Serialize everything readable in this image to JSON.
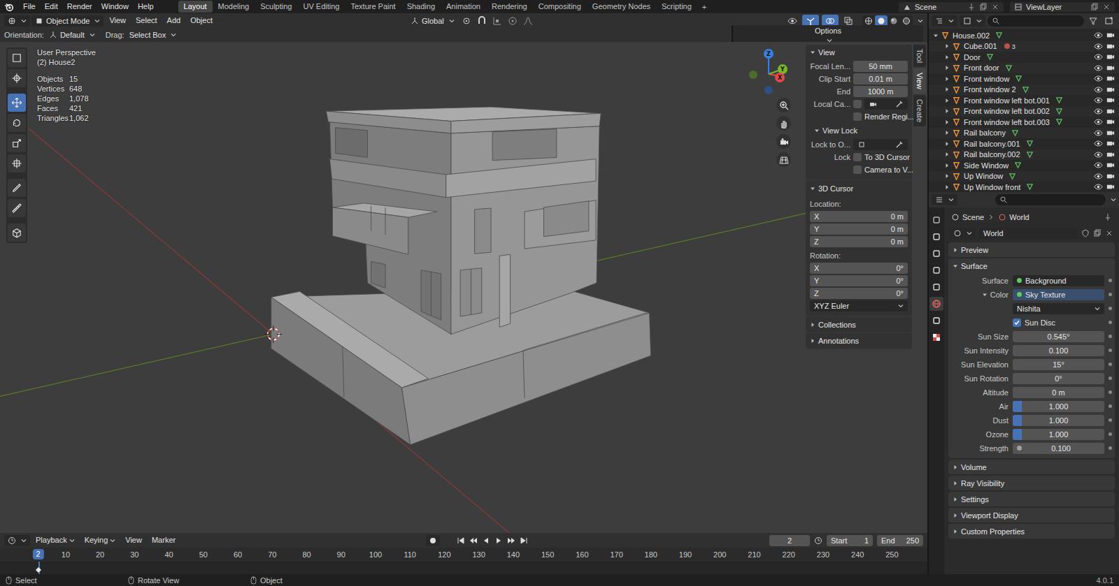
{
  "topbar": {
    "menus": [
      "File",
      "Edit",
      "Render",
      "Window",
      "Help"
    ],
    "workspaces": [
      {
        "label": "Layout",
        "selected": true
      },
      {
        "label": "Modeling",
        "selected": false
      },
      {
        "label": "Sculpting",
        "selected": false
      },
      {
        "label": "UV Editing",
        "selected": false
      },
      {
        "label": "Texture Paint",
        "selected": false
      },
      {
        "label": "Shading",
        "selected": false
      },
      {
        "label": "Animation",
        "selected": false
      },
      {
        "label": "Rendering",
        "selected": false
      },
      {
        "label": "Compositing",
        "selected": false
      },
      {
        "label": "Geometry Nodes",
        "selected": false
      },
      {
        "label": "Scripting",
        "selected": false
      }
    ],
    "add_workspace": "+",
    "scene": "Scene",
    "view_layer": "ViewLayer"
  },
  "viewport_header": {
    "mode": "Object Mode",
    "menus": [
      "View",
      "Select",
      "Add",
      "Object"
    ],
    "orientation": "Global",
    "shading": [
      {
        "selected": false
      },
      {
        "selected": true
      },
      {
        "selected": false
      },
      {
        "selected": false
      }
    ]
  },
  "tool_settings": {
    "orientation_label": "Orientation:",
    "orientation": "Default",
    "drag_label": "Drag:",
    "drag": "Select Box",
    "options": "Options"
  },
  "viewport": {
    "view_name": "User Perspective",
    "active_object": "(2) House2",
    "stats": [
      {
        "label": "Objects",
        "value": "15"
      },
      {
        "label": "Vertices",
        "value": "648"
      },
      {
        "label": "Edges",
        "value": "1,078"
      },
      {
        "label": "Faces",
        "value": "421"
      },
      {
        "label": "Triangles",
        "value": "1,062"
      }
    ],
    "gizmo_axes": [
      "X",
      "Y",
      "Z"
    ],
    "tools": [
      {
        "selected": false
      },
      {
        "selected": false
      },
      {
        "selected": true
      },
      {
        "selected": false
      },
      {
        "selected": false
      },
      {
        "selected": false
      },
      {
        "selected": false
      },
      {
        "selected": false
      },
      {
        "selected": false
      }
    ]
  },
  "sidebar": {
    "tabs": [
      {
        "label": "Tool",
        "selected": false
      },
      {
        "label": "View",
        "selected": true
      },
      {
        "label": "Create",
        "selected": false
      }
    ],
    "panels": [
      {
        "title": "View",
        "expanded": true,
        "rows": [
          {
            "kind": "field",
            "label": "Focal Len...",
            "value": "50 mm"
          },
          {
            "kind": "field",
            "label": "Clip Start",
            "value": "0.01 m"
          },
          {
            "kind": "field",
            "label": "End",
            "value": "1000 m"
          },
          {
            "kind": "camera",
            "label": "Local Ca...",
            "checked": false
          },
          {
            "kind": "check",
            "label": "Render Regi...",
            "checked": false
          },
          {
            "kind": "subpanel",
            "label": "View Lock",
            "expanded": true
          },
          {
            "kind": "object",
            "label": "Lock to O..."
          },
          {
            "kind": "labeled-check",
            "label": "Lock",
            "text": "To 3D Cursor",
            "checked": false
          },
          {
            "kind": "check",
            "label": "Camera to V...",
            "checked": false
          }
        ]
      },
      {
        "title": "3D Cursor",
        "expanded": true,
        "rows": [
          {
            "kind": "heading",
            "label": "Location:"
          },
          {
            "kind": "axis",
            "label": "X",
            "value": "0 m"
          },
          {
            "kind": "axis",
            "label": "Y",
            "value": "0 m"
          },
          {
            "kind": "axis",
            "label": "Z",
            "value": "0 m"
          },
          {
            "kind": "heading",
            "label": "Rotation:"
          },
          {
            "kind": "axis",
            "label": "X",
            "value": "0°"
          },
          {
            "kind": "axis",
            "label": "Y",
            "value": "0°"
          },
          {
            "kind": "axis",
            "label": "Z",
            "value": "0°"
          },
          {
            "kind": "dropdown",
            "value": "XYZ Euler"
          }
        ]
      },
      {
        "title": "Collections",
        "expanded": false,
        "rows": []
      },
      {
        "title": "Annotations",
        "expanded": false,
        "rows": []
      }
    ]
  },
  "outliner": {
    "items": [
      {
        "name": "House.002",
        "depth": 0,
        "expanded": true,
        "visible": true,
        "renderable": true
      },
      {
        "name": "Cube.001",
        "depth": 1,
        "expanded": false,
        "visible": true,
        "renderable": true,
        "badge": "3"
      },
      {
        "name": "Door",
        "depth": 1,
        "expanded": false,
        "visible": true,
        "renderable": true
      },
      {
        "name": "Front door",
        "depth": 1,
        "expanded": false,
        "visible": true,
        "renderable": true
      },
      {
        "name": "Front window",
        "depth": 1,
        "expanded": false,
        "visible": true,
        "renderable": true
      },
      {
        "name": "Front window 2",
        "depth": 1,
        "expanded": false,
        "visible": true,
        "renderable": true
      },
      {
        "name": "Front window left bot.001",
        "depth": 1,
        "expanded": false,
        "visible": true,
        "renderable": true
      },
      {
        "name": "Front window left bot.002",
        "depth": 1,
        "expanded": false,
        "visible": true,
        "renderable": true
      },
      {
        "name": "Front window left bot.003",
        "depth": 1,
        "expanded": false,
        "visible": true,
        "renderable": true
      },
      {
        "name": "Rail balcony",
        "depth": 1,
        "expanded": false,
        "visible": true,
        "renderable": true
      },
      {
        "name": "Rail balcony.001",
        "depth": 1,
        "expanded": false,
        "visible": true,
        "renderable": true
      },
      {
        "name": "Rail balcony.002",
        "depth": 1,
        "expanded": false,
        "visible": true,
        "renderable": true
      },
      {
        "name": "Side Window",
        "depth": 1,
        "expanded": false,
        "visible": true,
        "renderable": true
      },
      {
        "name": "Up Window",
        "depth": 1,
        "expanded": false,
        "visible": true,
        "renderable": true
      },
      {
        "name": "Up Window front",
        "depth": 1,
        "expanded": false,
        "visible": true,
        "renderable": true
      }
    ]
  },
  "properties": {
    "breadcrumb": [
      "Scene",
      "World"
    ],
    "datablock": "World",
    "tabs": [
      {
        "selected": false
      },
      {
        "selected": false
      },
      {
        "selected": false
      },
      {
        "selected": false
      },
      {
        "selected": false
      },
      {
        "selected": true
      },
      {
        "selected": false
      },
      {
        "selected": false
      }
    ],
    "panels": [
      {
        "title": "Preview",
        "expanded": false,
        "rows": []
      },
      {
        "title": "Surface",
        "expanded": true,
        "rows": [
          {
            "kind": "socket",
            "label": "Surface",
            "value": "Background",
            "highlighted": false
          },
          {
            "kind": "socket-group",
            "label": "Color",
            "value": "Sky Texture",
            "highlighted": true,
            "expanded": true
          },
          {
            "kind": "dropdown",
            "value": "Nishita"
          },
          {
            "kind": "check",
            "label": "Sun Disc",
            "checked": true
          },
          {
            "kind": "field",
            "label": "Sun Size",
            "value": "0.545°"
          },
          {
            "kind": "field",
            "label": "Sun Intensity",
            "value": "0.100"
          },
          {
            "kind": "field",
            "label": "Sun Elevation",
            "value": "15°"
          },
          {
            "kind": "field",
            "label": "Sun Rotation",
            "value": "0°"
          },
          {
            "kind": "field",
            "label": "Altitude",
            "value": "0 m"
          },
          {
            "kind": "slider",
            "label": "Air",
            "value": "1.000",
            "level": 0.1
          },
          {
            "kind": "slider",
            "label": "Dust",
            "value": "1.000",
            "level": 0.1
          },
          {
            "kind": "slider",
            "label": "Ozone",
            "value": "1.000",
            "level": 0.1
          },
          {
            "kind": "socket-value",
            "label": "Strength",
            "value": "0.100"
          }
        ]
      },
      {
        "title": "Volume",
        "expanded": false,
        "rows": []
      },
      {
        "title": "Ray Visibility",
        "expanded": false,
        "rows": []
      },
      {
        "title": "Settings",
        "expanded": false,
        "rows": []
      },
      {
        "title": "Viewport Display",
        "expanded": false,
        "rows": []
      },
      {
        "title": "Custom Properties",
        "expanded": false,
        "rows": []
      }
    ]
  },
  "timeline": {
    "menus": [
      {
        "label": "Playback",
        "dropdown": true
      },
      {
        "label": "Keying",
        "dropdown": true
      },
      {
        "label": "View",
        "dropdown": false
      },
      {
        "label": "Marker",
        "dropdown": false
      }
    ],
    "current_frame": "2",
    "start_label": "Start",
    "start": "1",
    "end_label": "End",
    "end": "250",
    "playhead": "2",
    "ticks": [
      "10",
      "20",
      "30",
      "40",
      "50",
      "60",
      "70",
      "80",
      "90",
      "100",
      "110",
      "120",
      "130",
      "140",
      "150",
      "160",
      "170",
      "180",
      "190",
      "200",
      "210",
      "220",
      "230",
      "240",
      "250"
    ]
  },
  "status_bar": {
    "items": [
      "Select",
      "Rotate View",
      "Object"
    ],
    "version": "4.0.1"
  }
}
